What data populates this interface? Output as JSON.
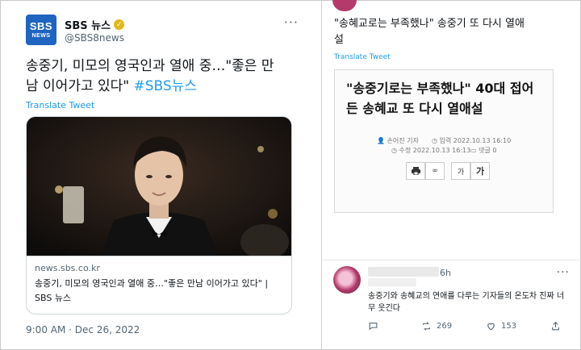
{
  "left_tweet": {
    "account_name": "SBS 뉴스",
    "account_handle": "@SBS8news",
    "logo_text_main": "SBS",
    "logo_text_sub": "NEWS",
    "more_icon": "more-horizontal-icon",
    "text_line1": "송중기, 미모의 영국인과 열애 중…\"좋은 만",
    "text_line2": "남 이어가고 있다\" ",
    "hashtag": "#SBS뉴스",
    "translate": "Translate Tweet",
    "card": {
      "domain": "news.sbs.co.kr",
      "title": "송중기, 미모의 영국인과 열애 중…\"좋은 만남 이어가고 있다\" |",
      "title_suffix": "SBS 뉴스"
    },
    "timestamp": "9:00 AM · Dec 26, 2022"
  },
  "right_top": {
    "text_line1": "\"송혜교로는 부족했나\" 송중기 또 다시 열애",
    "text_line2": "설",
    "translate": "Translate Tweet",
    "article": {
      "headline_line1": "\"송중기로는 부족했나\" 40대 접어",
      "headline_line2": "든 송혜교 또 다시 열애설",
      "reporter": "손어진 기자",
      "input_date": "입력 2022.10.13 16:10",
      "modified_date": "수정 2022.10.13 16:13",
      "comments": "댓글 0",
      "font_small": "가",
      "font_large": "가"
    }
  },
  "reply": {
    "time": "6h",
    "text_line1": "송중기와 송혜교의 연애를 다루는 기자들의 온도차 진짜 너",
    "text_line2": "무 웃긴다",
    "retweets": "269",
    "likes": "153"
  },
  "colors": {
    "accent_blue": "#1d9bf0",
    "sbs_blue": "#1f64c0",
    "verified_gold": "#e2b719",
    "muted": "#536471"
  }
}
